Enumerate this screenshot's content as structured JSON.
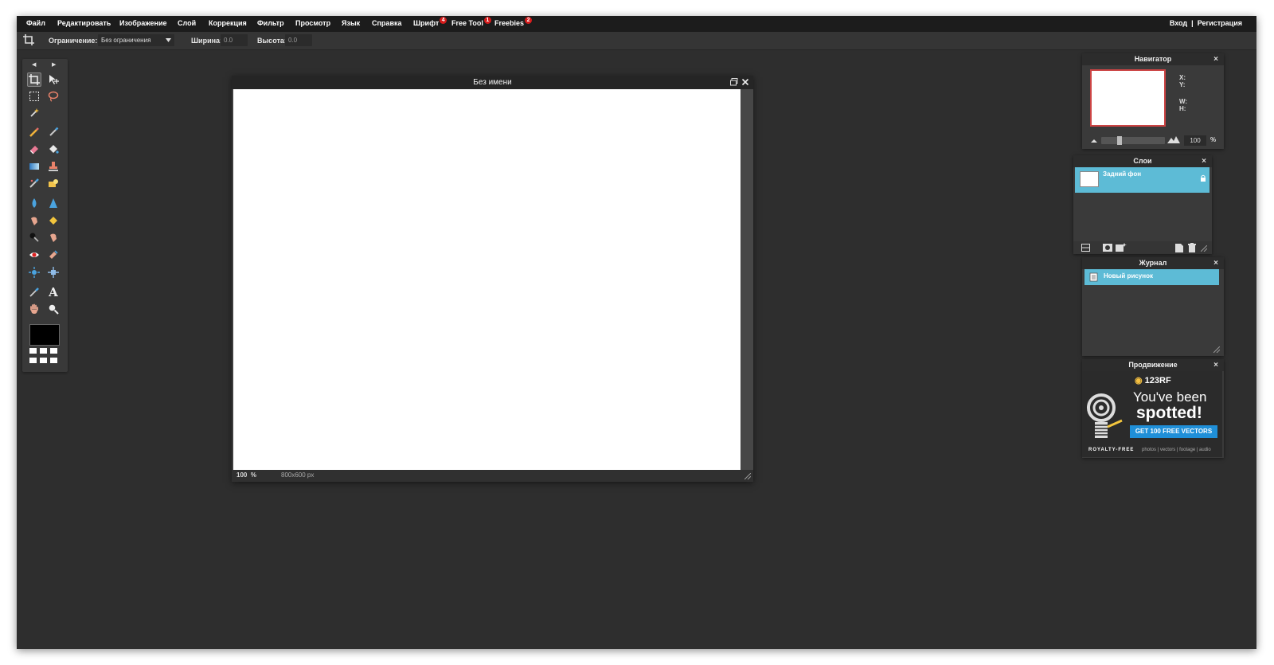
{
  "menu": {
    "items": [
      {
        "label": "Файл"
      },
      {
        "label": "Редактировать"
      },
      {
        "label": "Изображение"
      },
      {
        "label": "Слой"
      },
      {
        "label": "Коррекция"
      },
      {
        "label": "Фильтр"
      },
      {
        "label": "Просмотр"
      },
      {
        "label": "Язык"
      },
      {
        "label": "Справка"
      },
      {
        "label": "Шрифт",
        "badge": "4"
      },
      {
        "label": "Free Tool",
        "badge": "1"
      },
      {
        "label": "Freebies",
        "badge": "2"
      }
    ],
    "login": "Вход",
    "separator": "|",
    "register": "Регистрация"
  },
  "options": {
    "constraint_label": "Ограничение:",
    "constraint_value": "Без ограничения",
    "width_label": "Ширина:",
    "width_value": "0.0",
    "height_label": "Высота:",
    "height_value": "0.0"
  },
  "toolbox": {
    "foreground_color": "#000000"
  },
  "document": {
    "title": "Без имени",
    "zoom": "100",
    "zoom_unit": "%",
    "size": "800x600 px"
  },
  "navigator": {
    "title": "Навигатор",
    "x_label": "X:",
    "y_label": "Y:",
    "w_label": "W:",
    "h_label": "H:",
    "zoom_value": "100",
    "zoom_unit": "%"
  },
  "layers": {
    "title": "Слои",
    "items": [
      {
        "name": "Задний фон"
      }
    ]
  },
  "history": {
    "title": "Журнал",
    "items": [
      {
        "name": "Новый рисунок"
      }
    ]
  },
  "promo": {
    "title": "Продвижение",
    "brand": "123RF",
    "line1": "You've been",
    "line2": "spotted!",
    "cta": "GET 100 FREE VECTORS",
    "royalty": "ROYALTY-FREE",
    "types": "photos | vectors | footage | audio"
  },
  "colors": {
    "accent": "#5dbbd6",
    "badge": "#d51b1b",
    "cta": "#1f8fd8"
  }
}
